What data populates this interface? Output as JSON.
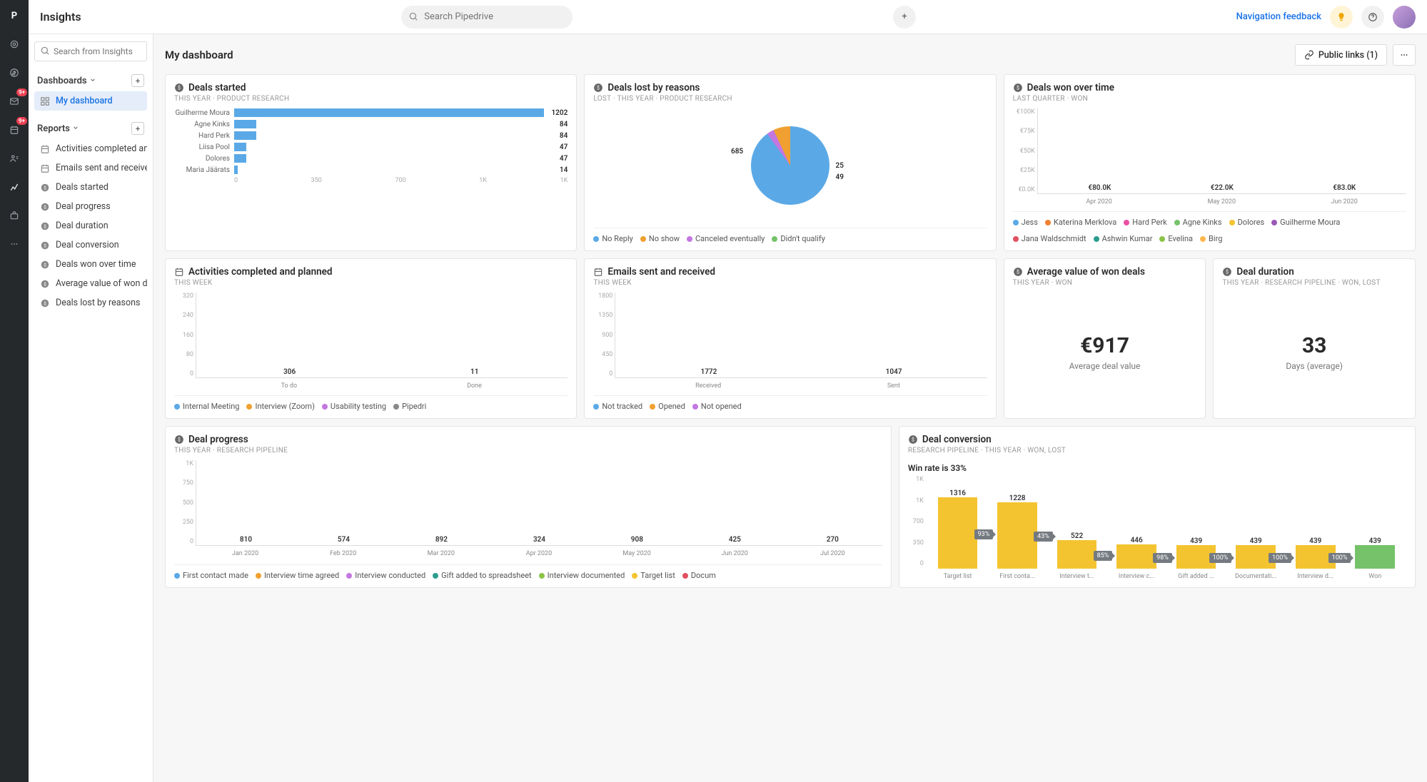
{
  "app": {
    "title": "Insights"
  },
  "search": {
    "global_placeholder": "Search Pipedrive",
    "sidebar_placeholder": "Search from Insights"
  },
  "topbar": {
    "nav_feedback": "Navigation feedback",
    "public_links": "Public links (1)"
  },
  "sidebar": {
    "dashboards_label": "Dashboards",
    "reports_label": "Reports",
    "dashboards": [
      {
        "label": "My dashboard",
        "active": true
      }
    ],
    "reports": [
      {
        "label": "Activities completed and …",
        "icon": "calendar"
      },
      {
        "label": "Emails sent and received",
        "icon": "calendar"
      },
      {
        "label": "Deals started",
        "icon": "currency"
      },
      {
        "label": "Deal progress",
        "icon": "currency"
      },
      {
        "label": "Deal duration",
        "icon": "currency"
      },
      {
        "label": "Deal conversion",
        "icon": "currency"
      },
      {
        "label": "Deals won over time",
        "icon": "currency"
      },
      {
        "label": "Average value of won deals",
        "icon": "currency"
      },
      {
        "label": "Deals lost by reasons",
        "icon": "currency"
      }
    ]
  },
  "page_title": "My dashboard",
  "cards": {
    "deals_started": {
      "title": "Deals started",
      "sub": "THIS YEAR · PRODUCT RESEARCH"
    },
    "deals_lost": {
      "title": "Deals lost by reasons",
      "sub": "LOST · THIS YEAR · PRODUCT RESEARCH"
    },
    "deals_won_time": {
      "title": "Deals won over time",
      "sub": "LAST QUARTER · WON"
    },
    "activities": {
      "title": "Activities completed and planned",
      "sub": "THIS WEEK"
    },
    "emails": {
      "title": "Emails sent and received",
      "sub": "THIS WEEK"
    },
    "avg_value": {
      "title": "Average value of won deals",
      "sub": "THIS YEAR · WON",
      "kpi": "€917",
      "kpi_label": "Average deal value"
    },
    "duration": {
      "title": "Deal duration",
      "sub": "THIS YEAR · RESEARCH PIPELINE · WON, LOST",
      "kpi": "33",
      "kpi_label": "Days (average)"
    },
    "progress": {
      "title": "Deal progress",
      "sub": "THIS YEAR · RESEARCH PIPELINE"
    },
    "conversion": {
      "title": "Deal conversion",
      "sub": "RESEARCH PIPELINE · THIS YEAR · WON, LOST",
      "winrate": "Win rate is 33%"
    }
  },
  "chart_data": {
    "deals_started": {
      "type": "bar",
      "orientation": "horizontal",
      "categories": [
        "Guilherme Moura",
        "Agne Kinks",
        "Hard Perk",
        "Liisa Pool",
        "Dolores",
        "Maria Jäärats"
      ],
      "values": [
        1202,
        84,
        84,
        47,
        47,
        14
      ],
      "x_ticks": [
        "0",
        "350",
        "700",
        "1K",
        "1K"
      ]
    },
    "deals_lost": {
      "type": "pie",
      "series": [
        {
          "name": "No Reply",
          "value": 685,
          "color": "#5aa9e6"
        },
        {
          "name": "No show",
          "value": 49,
          "color": "#f0a030"
        },
        {
          "name": "Canceled eventually",
          "value": 25,
          "color": "#c377e0"
        },
        {
          "name": "Didn't qualify",
          "value": 0,
          "color": "#75c26a"
        }
      ],
      "labels_shown": [
        "685",
        "25",
        "49"
      ]
    },
    "deals_won_time": {
      "type": "bar",
      "stacked": true,
      "categories": [
        "Apr 2020",
        "May 2020",
        "Jun 2020"
      ],
      "totals": [
        "€80.0K",
        "€22.0K",
        "€83.0K"
      ],
      "y_ticks": [
        "€0.0K",
        "€25K",
        "€50K",
        "€75K",
        "€100K"
      ],
      "legend": [
        "Jess",
        "Katerina Merklova",
        "Hard Perk",
        "Agne Kinks",
        "Dolores",
        "Guilherme Moura",
        "Jana Waldschmidt",
        "Ashwin Kumar",
        "Evelina",
        "Birg"
      ],
      "colors": [
        "#5aa9e6",
        "#f08030",
        "#e84fa5",
        "#75c26a",
        "#f4c430",
        "#9b59b6",
        "#e05060",
        "#2a9d8f",
        "#8bc34a",
        "#ffb74d"
      ]
    },
    "activities": {
      "type": "bar",
      "stacked": true,
      "categories": [
        "To do",
        "Done"
      ],
      "values": [
        306,
        11
      ],
      "y_ticks": [
        "0",
        "80",
        "160",
        "240",
        "320"
      ],
      "legend": [
        "Internal Meeting",
        "Interview (Zoom)",
        "Usability testing",
        "Pipedri"
      ],
      "legend_colors": [
        "#5aa9e6",
        "#f0a030",
        "#c377e0",
        "#888"
      ]
    },
    "emails": {
      "type": "bar",
      "categories": [
        "Received",
        "Sent"
      ],
      "values": [
        1772,
        1047
      ],
      "y_ticks": [
        "0",
        "450",
        "900",
        "1350",
        "1800"
      ],
      "legend": [
        "Not tracked",
        "Opened",
        "Not opened"
      ],
      "legend_colors": [
        "#5aa9e6",
        "#f0a030",
        "#c377e0"
      ]
    },
    "progress": {
      "type": "bar",
      "stacked": true,
      "categories": [
        "Jan 2020",
        "Feb 2020",
        "Mar 2020",
        "Apr 2020",
        "May 2020",
        "Jun 2020",
        "Jul 2020"
      ],
      "values": [
        810,
        574,
        892,
        324,
        908,
        425,
        270
      ],
      "y_ticks": [
        "0",
        "250",
        "500",
        "750",
        "1K"
      ],
      "legend": [
        "First contact made",
        "Interview time agreed",
        "Interview conducted",
        "Gift added to spreadsheet",
        "Interview documented",
        "Target list",
        "Docum"
      ],
      "legend_colors": [
        "#5aa9e6",
        "#f0a030",
        "#c377e0",
        "#2a9d8f",
        "#8bc34a",
        "#f4c430",
        "#e05060"
      ]
    },
    "conversion": {
      "type": "funnel",
      "categories": [
        "Target list",
        "First conta...",
        "Interview t...",
        "Interview c...",
        "Gift added ...",
        "Documentati...",
        "Interview d...",
        "Won"
      ],
      "values": [
        1316,
        1228,
        522,
        446,
        439,
        439,
        439,
        439
      ],
      "pct": [
        "93%",
        "43%",
        "85%",
        "98%",
        "100%",
        "100%",
        "100%"
      ],
      "y_ticks": [
        "0",
        "350",
        "700",
        "1K",
        "1K"
      ],
      "won_color": "#75c26a",
      "bar_color": "#f4c430"
    }
  }
}
